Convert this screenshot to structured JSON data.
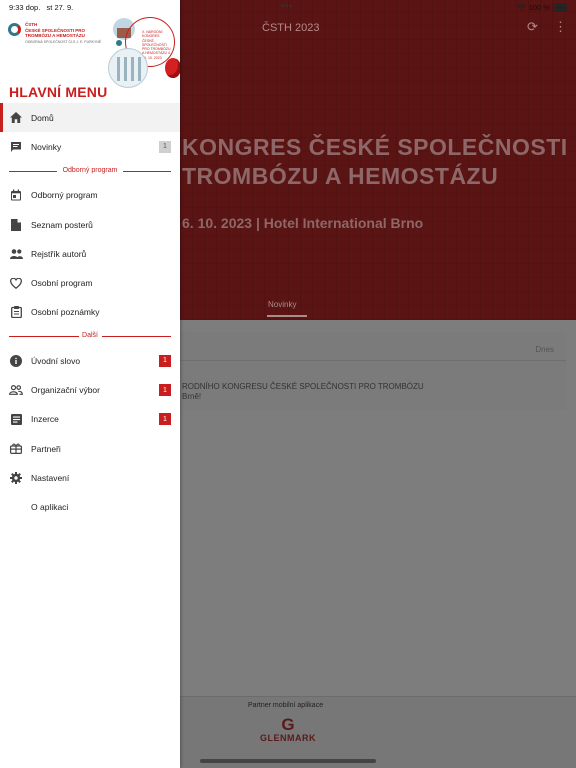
{
  "status_bar": {
    "time": "9:33 dop.",
    "date": "st 27. 9.",
    "battery": "100 %"
  },
  "app": {
    "title": "ČSTH 2023"
  },
  "header": {
    "line1": "KONGRES ČESKÉ SPOLEČNOSTI",
    "line2": "TROMBÓZU  A HEMOSTÁZU",
    "line3": "6. 10. 2023  |  Hotel International Brno",
    "tab": "Novinky"
  },
  "news_card": {
    "date": "Dnes",
    "text1": "RODNÍHO KONGRESU ČESKÉ SPOLEČNOSTI PRO TROMBÓZU",
    "text2": "Brně!"
  },
  "footer": {
    "partner_label": "Partner mobilní aplikace",
    "partner_logo": "GLENMARK"
  },
  "drawer": {
    "banner": {
      "org_name": "ČSTH",
      "org_line": "ČESKÉ SPOLEČNOSTI PRO TROMBÓZU A HEMOSTÁZU",
      "org_sub": "ODBORNÁ SPOLEČNOST ČLS J. E. PURKYNĚ",
      "event_text": "X. NÁRODNÍ KONGRES ČESKÉ SPOLEČNOSTI PRO TROMBÓZU A HEMOSTÁZU 4. - 6. 10. 2023"
    },
    "menu_title": "HLAVNÍ MENU",
    "items_main": [
      {
        "label": "Domů",
        "icon": "home-icon",
        "active": true
      },
      {
        "label": "Novinky",
        "icon": "chat-icon",
        "badge": "1",
        "badge_style": "gray"
      }
    ],
    "section1": "Odborný program",
    "items_program": [
      {
        "label": "Odborný program",
        "icon": "calendar-icon"
      },
      {
        "label": "Seznam posterů",
        "icon": "document-icon"
      },
      {
        "label": "Rejstřík autorů",
        "icon": "people-icon"
      },
      {
        "label": "Osobní program",
        "icon": "heart-icon"
      },
      {
        "label": "Osobní poznámky",
        "icon": "clipboard-icon"
      }
    ],
    "section2": "Další",
    "items_other": [
      {
        "label": "Úvodní slovo",
        "icon": "info-icon",
        "badge": "1",
        "badge_style": "red"
      },
      {
        "label": "Organizační výbor",
        "icon": "group-icon",
        "badge": "1",
        "badge_style": "red"
      },
      {
        "label": "Inzerce",
        "icon": "article-icon",
        "badge": "1",
        "badge_style": "red"
      },
      {
        "label": "Partneři",
        "icon": "gift-icon"
      },
      {
        "label": "Nastavení",
        "icon": "settings-icon"
      },
      {
        "label": "O aplikaci",
        "icon": ""
      }
    ]
  }
}
